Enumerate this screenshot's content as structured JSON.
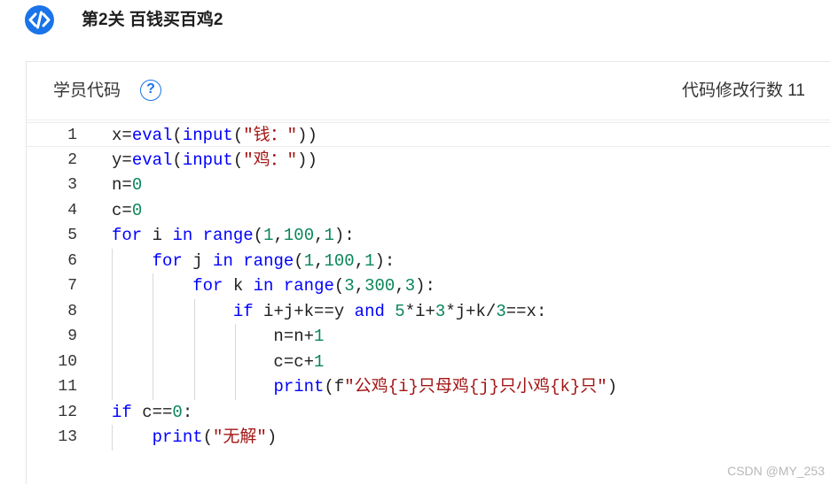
{
  "header": {
    "title": "第2关 百钱买百鸡2",
    "logo_icon": "code-icon"
  },
  "panel": {
    "label": "学员代码",
    "help_icon_glyph": "?",
    "edit_count": "代码修改行数 11"
  },
  "code": {
    "lines": [
      {
        "num": "1",
        "text": "x=eval(input(\"钱：\"))"
      },
      {
        "num": "2",
        "text": "y=eval(input(\"鸡：\"))"
      },
      {
        "num": "3",
        "text": "n=0"
      },
      {
        "num": "4",
        "text": "c=0"
      },
      {
        "num": "5",
        "text": "for i in range(1,100,1):"
      },
      {
        "num": "6",
        "text": "    for j in range(1,100,1):"
      },
      {
        "num": "7",
        "text": "        for k in range(3,300,3):"
      },
      {
        "num": "8",
        "text": "            if i+j+k==y and 5*i+3*j+k/3==x:"
      },
      {
        "num": "9",
        "text": "                n=n+1"
      },
      {
        "num": "10",
        "text": "                c=c+1"
      },
      {
        "num": "11",
        "text": "                print(f\"公鸡{i}只母鸡{j}只小鸡{k}只\")"
      },
      {
        "num": "12",
        "text": "if c==0:"
      },
      {
        "num": "13",
        "text": "    print(\"无解\")"
      }
    ]
  },
  "watermark": "CSDN @MY_253",
  "colors": {
    "accent": "#1a73e8",
    "keyword": "#0000ff",
    "number": "#098658",
    "string": "#a31515"
  }
}
